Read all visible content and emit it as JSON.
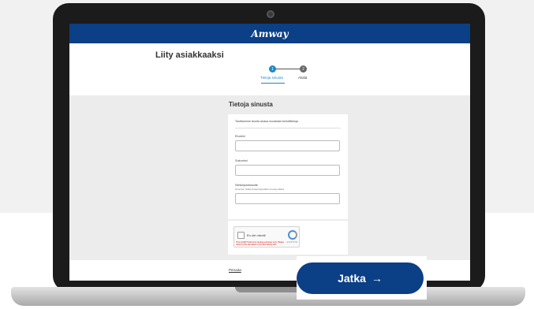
{
  "header": {
    "logo": "Amway"
  },
  "page": {
    "title": "Liity asiakkaaksi"
  },
  "steps": [
    {
      "number": "1",
      "label": "Tietoja sinusta"
    },
    {
      "number": "2",
      "label": "Aloita"
    }
  ],
  "form": {
    "section_title": "Tietoja sinusta",
    "intro": "Tarvitsemme sinulta alussa muutamia henkilötietoja",
    "first_name_label": "Etunimi",
    "last_name_label": "Sukunimi",
    "email_label": "Sähköpostiosoite",
    "email_hint": "Huomaa: Näitä tietoja käytetään Amway-tilillesi"
  },
  "captcha": {
    "label": "En ole robotti",
    "caption": "reCAPTCHA",
    "warning": "This reCAPTCHA is for testing purposes only. Please report to the site admin if you are seeing this."
  },
  "footer": {
    "cancel": "Peruuta"
  },
  "cta": {
    "label": "Jatka",
    "arrow": "→"
  },
  "colors": {
    "brand": "#0b3f86",
    "accent": "#1e88c8"
  }
}
